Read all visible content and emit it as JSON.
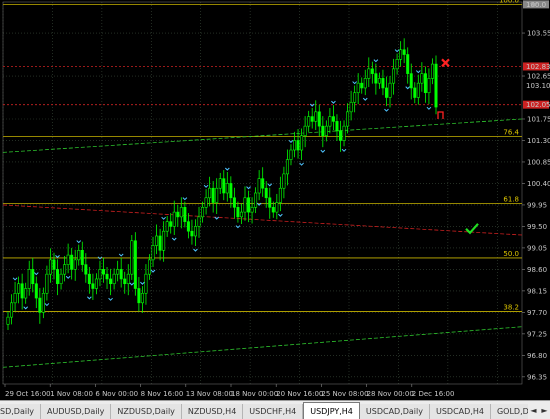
{
  "chart_data": {
    "type": "candlestick",
    "symbol_timeframe": "USDJPY,H4",
    "y_range": [
      96.2,
      104.2
    ],
    "price_ticks": [
      "103.55",
      "102.65",
      "101.75",
      "101.30",
      "100.85",
      "100.40",
      "99.95",
      "99.50",
      "99.05",
      "98.60",
      "98.15",
      "97.70",
      "97.25",
      "96.80",
      "96.35"
    ],
    "price_tick_values": [
      103.55,
      102.65,
      101.75,
      101.3,
      100.85,
      100.4,
      99.95,
      99.5,
      99.05,
      98.6,
      98.15,
      97.7,
      97.25,
      96.8,
      96.35
    ],
    "time_ticks": [
      "29 Oct 16:00",
      "1 Nov 08:00",
      "6 Nov 00:00",
      "8 Nov 16:00",
      "13 Nov 08:00",
      "18 Nov 00:00",
      "20 Nov 16:00",
      "25 Nov 08:00",
      "28 Nov 00:00",
      "2 Dec 16:00"
    ],
    "price_labels": {
      "current_high": "103.10",
      "current_low": "102.08",
      "top_label": "100.0",
      "red_box_a": "102.83",
      "red_box_b": "102.05"
    },
    "fib_levels": [
      {
        "label": "100.0",
        "price": 104.15
      },
      {
        "label": "76.4",
        "price": 101.38
      },
      {
        "label": "61.8",
        "price": 99.98
      },
      {
        "label": "50.0",
        "price": 98.84
      },
      {
        "label": "38.2",
        "price": 97.72
      }
    ],
    "red_level_prices": [
      102.85,
      102.05
    ],
    "closes": [
      97.6,
      97.9,
      98.1,
      98.3,
      98.0,
      98.2,
      98.6,
      98.3,
      98.0,
      97.7,
      98.1,
      98.5,
      98.8,
      98.6,
      98.3,
      98.5,
      98.7,
      98.9,
      98.6,
      98.8,
      99.0,
      98.7,
      98.5,
      98.3,
      98.2,
      98.4,
      98.6,
      98.5,
      98.4,
      98.3,
      98.5,
      98.6,
      98.4,
      98.3,
      98.5,
      99.2,
      98.2,
      97.9,
      98.1,
      98.5,
      98.8,
      99.1,
      99.3,
      99.0,
      99.4,
      99.6,
      99.5,
      99.8,
      99.7,
      99.9,
      99.6,
      99.4,
      99.3,
      99.5,
      99.7,
      99.9,
      100.1,
      100.3,
      100.0,
      100.3,
      100.5,
      100.2,
      100.4,
      100.1,
      99.9,
      99.7,
      99.8,
      100.1,
      99.8,
      99.9,
      100.2,
      100.5,
      100.3,
      100.1,
      99.9,
      99.8,
      100.0,
      100.3,
      100.6,
      100.9,
      101.1,
      101.3,
      101.1,
      101.4,
      101.6,
      101.8,
      101.7,
      101.9,
      101.6,
      101.4,
      101.6,
      101.8,
      101.7,
      101.5,
      101.3,
      101.6,
      101.9,
      102.1,
      102.3,
      102.5,
      102.4,
      102.6,
      102.8,
      102.7,
      102.5,
      102.6,
      102.4,
      102.2,
      102.5,
      102.8,
      103.0,
      103.2,
      103.1,
      102.7,
      102.4,
      102.2,
      102.5,
      102.7,
      102.3,
      102.6,
      102.9,
      102.0
    ]
  },
  "tabs": [
    {
      "label": "SD,Daily",
      "active": false
    },
    {
      "label": "AUDUSD,Daily",
      "active": false
    },
    {
      "label": "NZDUSD,Daily",
      "active": false
    },
    {
      "label": "NZDUSD,H4",
      "active": false
    },
    {
      "label": "USDCHF,H4",
      "active": false
    },
    {
      "label": "USDJPY,H4",
      "active": true
    },
    {
      "label": "USDCAD,Daily",
      "active": false
    },
    {
      "label": "USDCAD,H4",
      "active": false
    },
    {
      "label": "GOLD,Daily",
      "active": false
    },
    {
      "label": "GOLD,H4",
      "active": false
    }
  ],
  "colors": {
    "background": "#000000",
    "grid": "#3a4a3a",
    "bull": "#00ff00",
    "bear": "#00ff00",
    "fib_line": "#c8b400",
    "fib_text": "#e0c800",
    "red_level": "#cc2222",
    "trend_green": "#2ec62e",
    "trend_red": "#cc2020",
    "fractal": "#4fc4ff",
    "checkmark": "#22dd22",
    "x_mark": "#ff2222"
  },
  "nav": {
    "left": "◄",
    "right": "►"
  }
}
